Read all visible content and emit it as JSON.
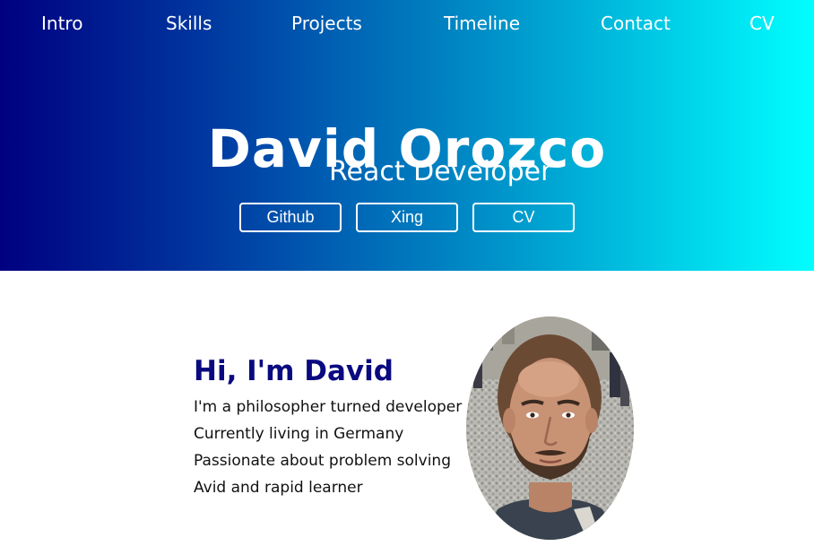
{
  "nav": {
    "items": [
      {
        "label": "Intro"
      },
      {
        "label": "Skills"
      },
      {
        "label": "Projects"
      },
      {
        "label": "Timeline"
      },
      {
        "label": "Contact"
      },
      {
        "label": "CV"
      }
    ]
  },
  "hero": {
    "name": "David Orozco",
    "role": "React Developer",
    "buttons": [
      {
        "label": "Github"
      },
      {
        "label": "Xing"
      },
      {
        "label": "CV"
      }
    ]
  },
  "intro": {
    "heading": "Hi, I'm David",
    "lines": [
      "I'm a philosopher turned developer",
      "Currently living in Germany",
      "Passionate about problem solving",
      "Avid and rapid learner"
    ]
  },
  "colors": {
    "gradient_start": "#000080",
    "gradient_end": "#00ffff",
    "heading": "#0a0a80",
    "text": "#111111"
  },
  "icons": {
    "avatar": "profile-photo"
  }
}
